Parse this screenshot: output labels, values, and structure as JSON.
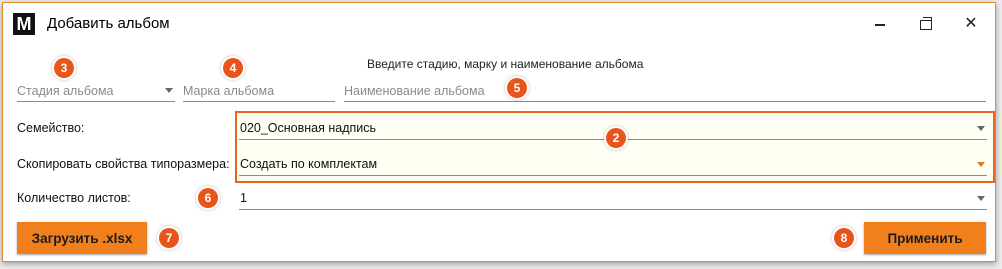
{
  "window": {
    "logo": "M",
    "title": "Добавить альбом",
    "controls": {
      "minimize": "minimize-icon",
      "maximize": "maximize-icon",
      "close": "close-icon"
    }
  },
  "hint": "Введите стадию, марку и наименование альбома",
  "fields": {
    "stage": {
      "placeholder": "Стадия альбома",
      "icon": "chevron-down-icon"
    },
    "mark": {
      "placeholder": "Марка альбома"
    },
    "name": {
      "placeholder": "Наименование альбома"
    }
  },
  "family": {
    "label": "Семейство:",
    "value": "020_Основная надпись"
  },
  "copy_props": {
    "label": "Скопировать свойства типоразмера:",
    "value": "Создать по комплектам"
  },
  "sheets": {
    "label": "Количество листов:",
    "value": "1"
  },
  "buttons": {
    "load": "Загрузить .xlsx",
    "apply": "Применить"
  },
  "badges": [
    "2",
    "3",
    "4",
    "5",
    "6",
    "7",
    "8"
  ],
  "colors": {
    "accent": "#f07f1c",
    "badge": "#e8541a",
    "highlight_border": "#e8641b"
  }
}
